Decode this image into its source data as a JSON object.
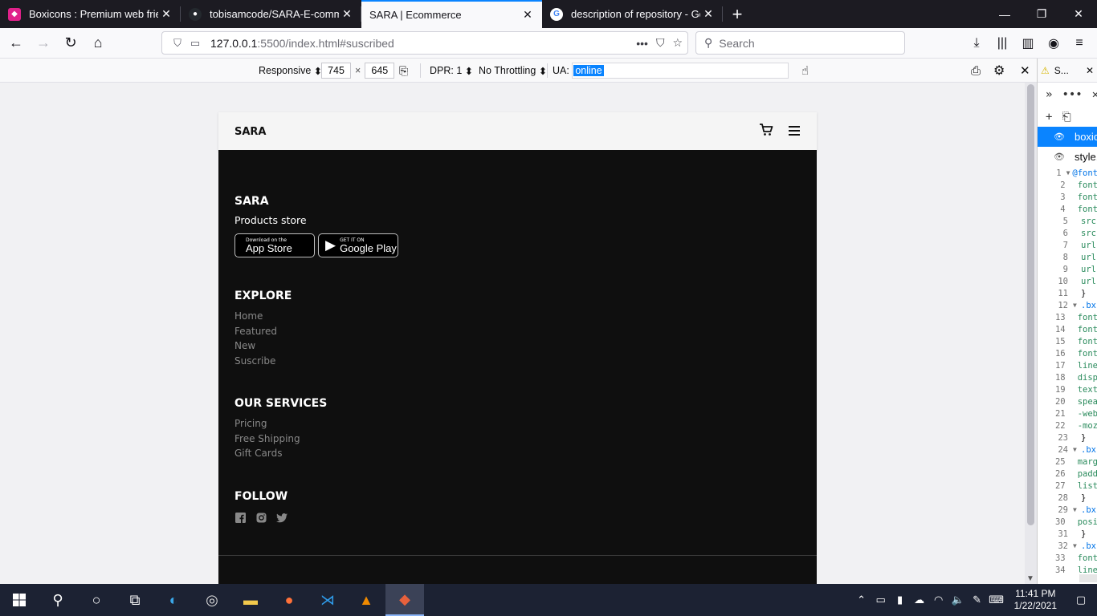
{
  "browser": {
    "tabs": [
      {
        "title": "Boxicons : Premium web friendly icons",
        "icon": "boxicons-favicon",
        "active": false
      },
      {
        "title": "tobisamcode/SARA-E-commerce",
        "icon": "github-favicon",
        "active": false
      },
      {
        "title": "SARA | Ecommerce",
        "icon": "",
        "active": true
      },
      {
        "title": "description of repository - Google Search",
        "icon": "google-favicon",
        "active": false
      }
    ],
    "url_host": "127.0.0.1",
    "url_rest": ":5500/index.html#suscribed",
    "search_placeholder": "Search"
  },
  "rdm": {
    "device": "Responsive",
    "width": "745",
    "times": "×",
    "height": "645",
    "dpr": "DPR: 1",
    "throttling": "No Throttling",
    "ua_label": "UA:",
    "ua_value": "online"
  },
  "site": {
    "logo": "SARA",
    "footer": {
      "brand": "SARA",
      "tagline": "Products store",
      "app_store_small": "Download on the",
      "app_store_big": "App Store",
      "google_play_small": "GET IT ON",
      "google_play_big": "Google Play",
      "explore_title": "EXPLORE",
      "explore_links": [
        "Home",
        "Featured",
        "New",
        "Suscribe"
      ],
      "services_title": "OUR SERVICES",
      "services_links": [
        "Pricing",
        "Free Shipping",
        "Gift Cards"
      ],
      "follow_title": "FOLLOW",
      "social_icons": [
        "facebook-icon",
        "instagram-icon",
        "twitter-icon"
      ]
    }
  },
  "devtools": {
    "tab_label": "S...",
    "files": [
      {
        "name": "boxicons",
        "selected": true
      },
      {
        "name": "style.css",
        "selected": false
      }
    ],
    "code_lines": [
      {
        "n": "1",
        "fold": true,
        "t": "@font"
      },
      {
        "n": "2",
        "t": "  font"
      },
      {
        "n": "3",
        "t": "  font"
      },
      {
        "n": "4",
        "t": "  font"
      },
      {
        "n": "5",
        "t": "  src"
      },
      {
        "n": "6",
        "t": "  src"
      },
      {
        "n": "7",
        "t": "  url"
      },
      {
        "n": "8",
        "t": "  url"
      },
      {
        "n": "9",
        "t": "  url"
      },
      {
        "n": "10",
        "t": "  url"
      },
      {
        "n": "11",
        "t": "}"
      },
      {
        "n": "12",
        "fold": true,
        "t": ".bx"
      },
      {
        "n": "13",
        "t": "  font"
      },
      {
        "n": "14",
        "t": "  font"
      },
      {
        "n": "15",
        "t": "  font"
      },
      {
        "n": "16",
        "t": "  font"
      },
      {
        "n": "17",
        "t": "  line"
      },
      {
        "n": "18",
        "t": "  disp"
      },
      {
        "n": "19",
        "t": "  text"
      },
      {
        "n": "20",
        "t": "  spea"
      },
      {
        "n": "21",
        "t": "  -web"
      },
      {
        "n": "22",
        "t": "  -moz"
      },
      {
        "n": "23",
        "t": "}"
      },
      {
        "n": "24",
        "fold": true,
        "t": ".bx"
      },
      {
        "n": "25",
        "t": "  marg"
      },
      {
        "n": "26",
        "t": "  padd"
      },
      {
        "n": "27",
        "t": "  list"
      },
      {
        "n": "28",
        "t": "}"
      },
      {
        "n": "29",
        "fold": true,
        "t": ".bx"
      },
      {
        "n": "30",
        "t": "  posi"
      },
      {
        "n": "31",
        "t": "}"
      },
      {
        "n": "32",
        "fold": true,
        "t": ".bx"
      },
      {
        "n": "33",
        "t": "  font"
      },
      {
        "n": "34",
        "t": "  line"
      }
    ]
  },
  "taskbar": {
    "time": "11:41 PM",
    "date": "1/22/2021"
  },
  "colors": {
    "accent": "#0a84ff",
    "footer_bg": "#0f0f0f",
    "tab_bar": "#1c1b22",
    "taskbar": "#1c2233"
  }
}
